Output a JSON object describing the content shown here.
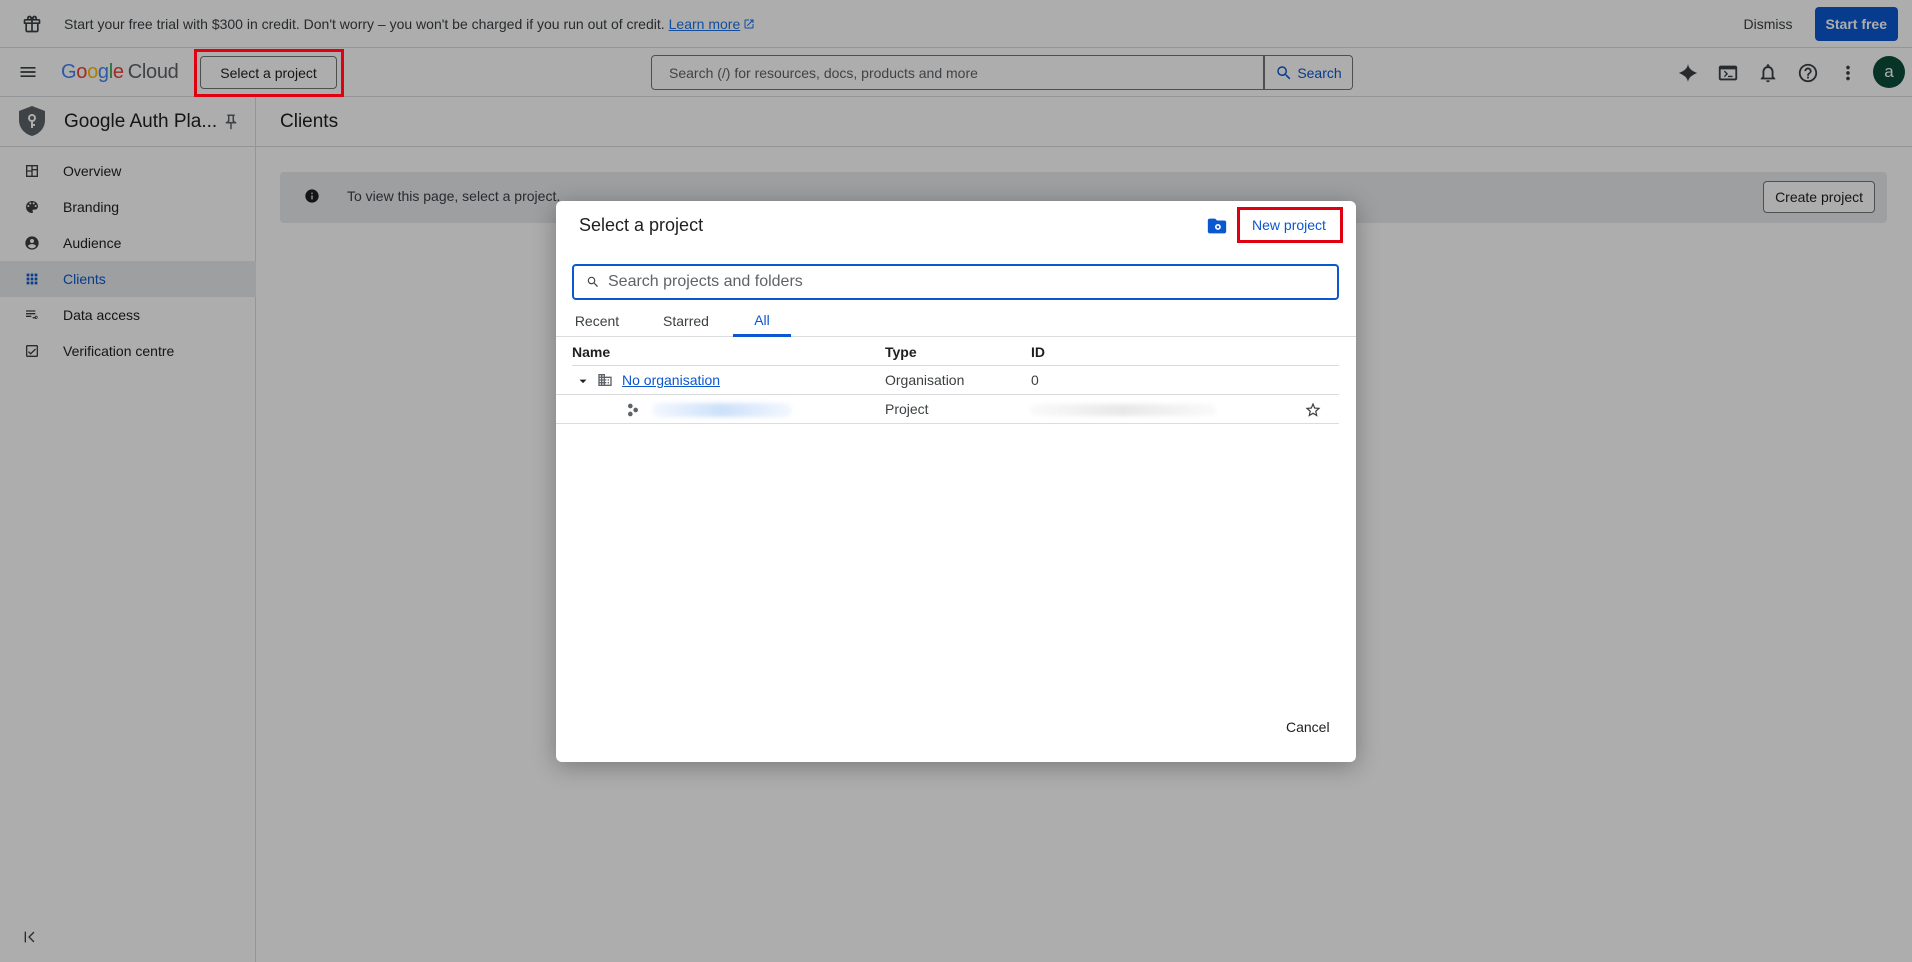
{
  "banner": {
    "text": "Start your free trial with $300 in credit. Don't worry – you won't be charged if you run out of credit.",
    "learn_more": "Learn more",
    "dismiss": "Dismiss",
    "start_free": "Start free"
  },
  "header": {
    "logo_google": "Google",
    "logo_cloud": "Cloud",
    "project_selector": "Select a project",
    "search_placeholder": "Search (/) for resources, docs, products and more",
    "search_button": "Search",
    "avatar_letter": "a"
  },
  "sidebar": {
    "product_name": "Google Auth Pla...",
    "items": [
      {
        "label": "Overview",
        "icon": "dashboard-icon"
      },
      {
        "label": "Branding",
        "icon": "palette-icon"
      },
      {
        "label": "Audience",
        "icon": "account-circle-icon"
      },
      {
        "label": "Clients",
        "icon": "apps-icon",
        "active": true
      },
      {
        "label": "Data access",
        "icon": "data-access-icon"
      },
      {
        "label": "Verification centre",
        "icon": "verification-icon"
      }
    ]
  },
  "main": {
    "title": "Clients",
    "info_text": "To view this page, select a project.",
    "create_project": "Create project"
  },
  "dialog": {
    "title": "Select a project",
    "new_project": "New project",
    "search_placeholder": "Search projects and folders",
    "tabs": [
      "Recent",
      "Starred",
      "All"
    ],
    "active_tab": "All",
    "columns": [
      "Name",
      "Type",
      "ID"
    ],
    "rows": [
      {
        "name": "No organisation",
        "type": "Organisation",
        "id": "0"
      },
      {
        "name": "",
        "type": "Project",
        "id": ""
      }
    ],
    "cancel": "Cancel"
  },
  "colors": {
    "accent": "#0b57d0",
    "highlight": "#e0000f",
    "avatar_bg": "#0b4d3a"
  }
}
